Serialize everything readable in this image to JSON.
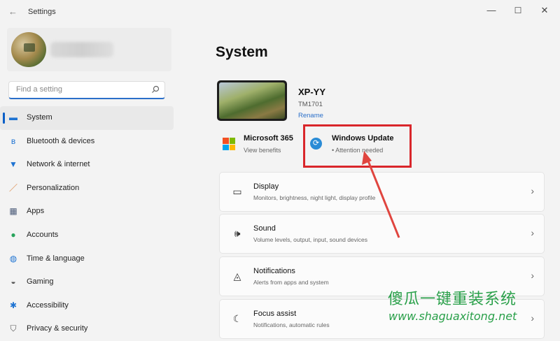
{
  "window": {
    "title": "Settings"
  },
  "search": {
    "placeholder": "Find a setting"
  },
  "sidebar": {
    "items": [
      {
        "label": "System",
        "active": true
      },
      {
        "label": "Bluetooth & devices"
      },
      {
        "label": "Network & internet"
      },
      {
        "label": "Personalization"
      },
      {
        "label": "Apps"
      },
      {
        "label": "Accounts"
      },
      {
        "label": "Time & language"
      },
      {
        "label": "Gaming"
      },
      {
        "label": "Accessibility"
      },
      {
        "label": "Privacy & security"
      }
    ]
  },
  "main": {
    "title": "System",
    "device": {
      "name": "XP-YY",
      "model": "TM1701",
      "rename": "Rename"
    },
    "ms365": {
      "title": "Microsoft 365",
      "subtitle": "View benefits"
    },
    "windows_update": {
      "title": "Windows Update",
      "subtitle": "• Attention needed"
    },
    "cards": [
      {
        "title": "Display",
        "subtitle": "Monitors, brightness, night light, display profile"
      },
      {
        "title": "Sound",
        "subtitle": "Volume levels, output, input, sound devices"
      },
      {
        "title": "Notifications",
        "subtitle": "Alerts from apps and system"
      },
      {
        "title": "Focus assist",
        "subtitle": "Notifications, automatic rules"
      }
    ]
  },
  "watermark": {
    "text": "傻瓜一键重装系统",
    "url": "www.shaguaxitong.net"
  },
  "colors": {
    "accent": "#0a5fc7",
    "highlight": "#d9262b",
    "watermark": "#2aa04a"
  }
}
